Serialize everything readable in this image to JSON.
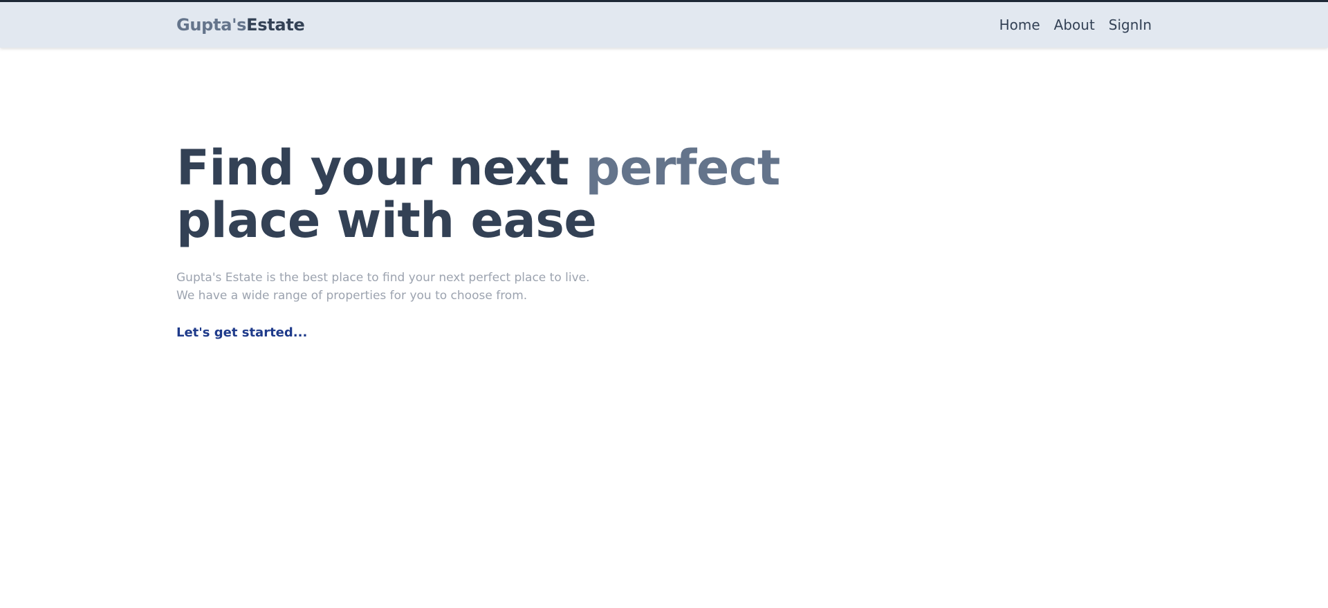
{
  "header": {
    "brand_part1": "Gupta's",
    "brand_part2": "Estate",
    "nav": [
      {
        "label": "Home"
      },
      {
        "label": "About"
      },
      {
        "label": "SignIn"
      }
    ]
  },
  "hero": {
    "title_part1": "Find your next ",
    "title_accent": "perfect",
    "title_part2": "place with ease",
    "subtitle_line1": "Gupta's Estate is the best place to find your next perfect place to live.",
    "subtitle_line2": "We have a wide range of properties for you to choose from.",
    "cta_label": "Let's get started..."
  },
  "colors": {
    "navbar_bg": "#e2e8f0",
    "brand_light": "#64748b",
    "text_dark": "#334155",
    "subtitle": "#9ca3af",
    "cta": "#1e3a8a"
  }
}
